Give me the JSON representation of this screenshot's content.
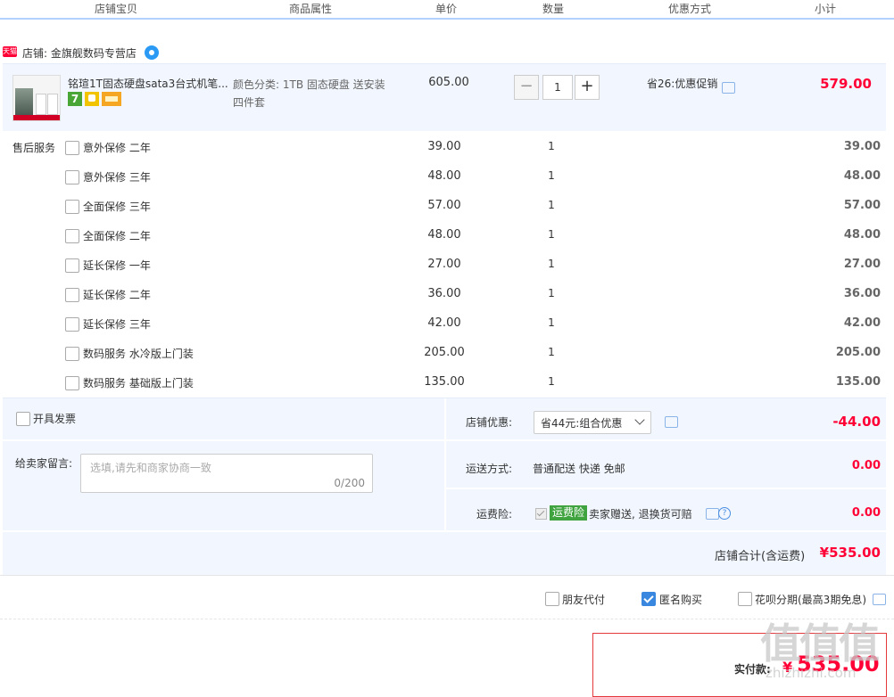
{
  "header": {
    "col_shop_item": "店铺宝贝",
    "col_attr": "商品属性",
    "col_price": "单价",
    "col_qty": "数量",
    "col_promo": "优惠方式",
    "col_subtotal": "小计"
  },
  "shop": {
    "platform_icon": "天猫",
    "label": "店铺: 金旗舰数码专营店"
  },
  "item": {
    "title": "铭瑄1T固态硬盘sata3台式机笔...",
    "badge_7": "7",
    "attr": "颜色分类: 1TB 固态硬盘 送安装四件套",
    "price": "605.00",
    "qty": "1",
    "minus": "−",
    "plus": "+",
    "promo": "省26:优惠促销",
    "subtotal": "579.00"
  },
  "services": {
    "label": "售后服务",
    "rows": [
      {
        "name": "意外保修 二年",
        "price": "39.00",
        "qty": "1",
        "subtotal": "39.00"
      },
      {
        "name": "意外保修 三年",
        "price": "48.00",
        "qty": "1",
        "subtotal": "48.00"
      },
      {
        "name": "全面保修 三年",
        "price": "57.00",
        "qty": "1",
        "subtotal": "57.00"
      },
      {
        "name": "全面保修 二年",
        "price": "48.00",
        "qty": "1",
        "subtotal": "48.00"
      },
      {
        "name": "延长保修 一年",
        "price": "27.00",
        "qty": "1",
        "subtotal": "27.00"
      },
      {
        "name": "延长保修 二年",
        "price": "36.00",
        "qty": "1",
        "subtotal": "36.00"
      },
      {
        "name": "延长保修 三年",
        "price": "42.00",
        "qty": "1",
        "subtotal": "42.00"
      },
      {
        "name": "数码服务 水冷版上门装",
        "price": "205.00",
        "qty": "1",
        "subtotal": "205.00"
      },
      {
        "name": "数码服务 基础版上门装",
        "price": "135.00",
        "qty": "1",
        "subtotal": "135.00"
      }
    ]
  },
  "order": {
    "invoice_label": "开具发票",
    "message_label": "给卖家留言:",
    "message_placeholder": "选填,请先和商家协商一致",
    "message_count": "0/200",
    "shop_discount_label": "店铺优惠:",
    "shop_discount_select": "省44元:组合优惠",
    "shop_discount_value": "-44.00",
    "shipping_label": "运送方式:",
    "shipping_text": "普通配送 快递 免邮",
    "shipping_value": "0.00",
    "freight_label": "运费险:",
    "freight_tag": "运费险",
    "freight_text": "卖家赠送, 退换货可赔",
    "freight_value": "0.00",
    "total_label": "店铺合计(含运费)",
    "total_value": "¥535.00"
  },
  "options": {
    "friend_pay": "朋友代付",
    "anonymous": "匿名购买",
    "huabei": "花呗分期(最高3期免息)"
  },
  "payment": {
    "label": "实付款:",
    "currency": "¥",
    "amount": "535.00"
  },
  "watermark": {
    "main": "值值值",
    "sub": "zhizhizhi.com"
  },
  "colors": {
    "price_red": "#ff0036",
    "accent_blue": "#3a87e0",
    "panel_bg": "#f2f7ff"
  }
}
